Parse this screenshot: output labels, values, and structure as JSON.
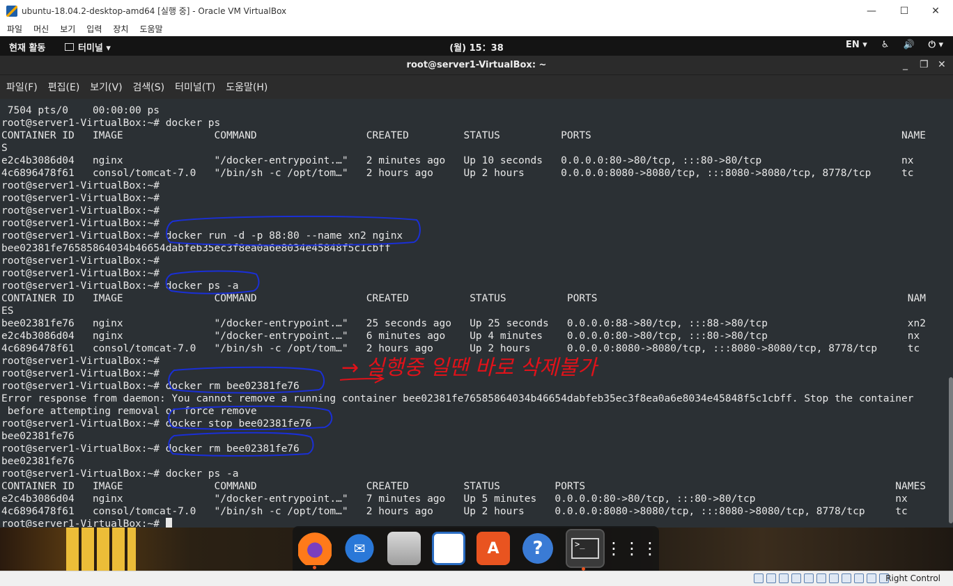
{
  "host_window": {
    "title": "ubuntu-18.04.2-desktop-amd64 [실행 중] - Oracle VM VirtualBox",
    "controls": {
      "minimize": "—",
      "maximize": "☐",
      "close": "✕"
    },
    "menu": [
      "파일",
      "머신",
      "보기",
      "입력",
      "장치",
      "도움말"
    ]
  },
  "gnome_topbar": {
    "activities": "현재 활동",
    "app_menu": "터미널 ▾",
    "clock": "(월) 15：38",
    "lang": "EN ▾",
    "icons": [
      "accessibility-icon",
      "volume-icon",
      "power-icon"
    ]
  },
  "terminal": {
    "title": "root@server1-VirtualBox: ~",
    "controls": {
      "minimize": "_",
      "maximize": "❐",
      "close": "✕"
    },
    "menu": [
      "파일(F)",
      "편집(E)",
      "보기(V)",
      "검색(S)",
      "터미널(T)",
      "도움말(H)"
    ],
    "lines": [
      " 7504 pts/0    00:00:00 ps",
      "root@server1-VirtualBox:~# docker ps",
      "CONTAINER ID   IMAGE               COMMAND                  CREATED         STATUS          PORTS                                                   NAME",
      "S",
      "e2c4b3086d04   nginx               \"/docker-entrypoint.…\"   2 minutes ago   Up 10 seconds   0.0.0.0:80->80/tcp, :::80->80/tcp                       nx",
      "4c6896478f61   consol/tomcat-7.0   \"/bin/sh -c /opt/tom…\"   2 hours ago     Up 2 hours      0.0.0.0:8080->8080/tcp, :::8080->8080/tcp, 8778/tcp     tc",
      "root@server1-VirtualBox:~#",
      "root@server1-VirtualBox:~#",
      "root@server1-VirtualBox:~#",
      "root@server1-VirtualBox:~#",
      "root@server1-VirtualBox:~# docker run -d -p 88:80 --name xn2 nginx",
      "bee02381fe76585864034b46654dabfeb35ec3f8ea0a6e8034e45848f5c1cbff",
      "root@server1-VirtualBox:~#",
      "root@server1-VirtualBox:~#",
      "root@server1-VirtualBox:~# docker ps -a",
      "CONTAINER ID   IMAGE               COMMAND                  CREATED          STATUS          PORTS                                                   NAM",
      "ES",
      "bee02381fe76   nginx               \"/docker-entrypoint.…\"   25 seconds ago   Up 25 seconds   0.0.0.0:88->80/tcp, :::88->80/tcp                       xn2",
      "e2c4b3086d04   nginx               \"/docker-entrypoint.…\"   6 minutes ago    Up 4 minutes    0.0.0.0:80->80/tcp, :::80->80/tcp                       nx",
      "4c6896478f61   consol/tomcat-7.0   \"/bin/sh -c /opt/tom…\"   2 hours ago      Up 2 hours      0.0.0.0:8080->8080/tcp, :::8080->8080/tcp, 8778/tcp     tc",
      "root@server1-VirtualBox:~#",
      "root@server1-VirtualBox:~#",
      "root@server1-VirtualBox:~# docker rm bee02381fe76",
      "Error response from daemon: You cannot remove a running container bee02381fe76585864034b46654dabfeb35ec3f8ea0a6e8034e45848f5c1cbff. Stop the container",
      " before attempting removal or force remove",
      "root@server1-VirtualBox:~# docker stop bee02381fe76",
      "bee02381fe76",
      "root@server1-VirtualBox:~# docker rm bee02381fe76",
      "bee02381fe76",
      "root@server1-VirtualBox:~# docker ps -a",
      "CONTAINER ID   IMAGE               COMMAND                  CREATED         STATUS         PORTS                                                   NAMES",
      "e2c4b3086d04   nginx               \"/docker-entrypoint.…\"   7 minutes ago   Up 5 minutes   0.0.0.0:80->80/tcp, :::80->80/tcp                       nx",
      "4c6896478f61   consol/tomcat-7.0   \"/bin/sh -c /opt/tom…\"   2 hours ago     Up 2 hours     0.0.0.0:8080->8080/tcp, :::8080->8080/tcp, 8778/tcp     tc"
    ],
    "prompt_line": "root@server1-VirtualBox:~# "
  },
  "annotation": {
    "handwritten_note": "→ 실행중 일땐 바로 삭제불가",
    "ink_blue": "#1a2fd6",
    "ink_red": "#e0121a"
  },
  "dock": {
    "items": [
      {
        "name": "firefox-icon",
        "glyph": ""
      },
      {
        "name": "thunderbird-icon",
        "glyph": "✉"
      },
      {
        "name": "files-icon",
        "glyph": ""
      },
      {
        "name": "writer-icon",
        "glyph": ""
      },
      {
        "name": "software-icon",
        "glyph": "A"
      },
      {
        "name": "help-icon",
        "glyph": "?"
      },
      {
        "name": "terminal-icon",
        "glyph": ">_"
      },
      {
        "name": "app-grid-icon",
        "glyph": "⋮⋮⋮"
      }
    ]
  },
  "vb_statusbar": {
    "host_key": "Right Control"
  }
}
